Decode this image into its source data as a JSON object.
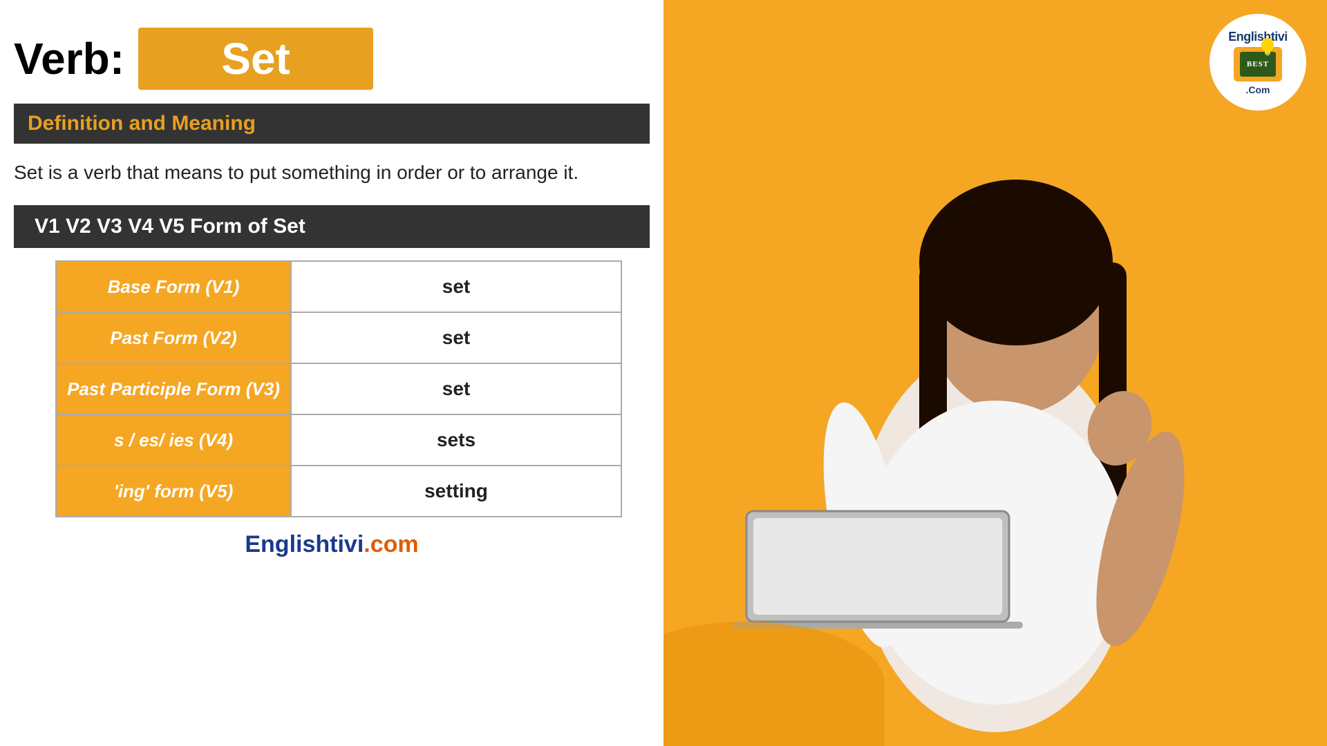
{
  "page": {
    "verb_label": "Verb:",
    "verb_word": "Set",
    "definition_heading": "Definition and Meaning",
    "definition_text": "Set is a verb that means to put something in order or to arrange it.",
    "forms_heading": "V1 V2 V3 V4 V5 Form of Set",
    "table": {
      "rows": [
        {
          "label": "Base Form (V1)",
          "value": "set"
        },
        {
          "label": "Past Form (V2)",
          "value": "set"
        },
        {
          "label": "Past Participle Form (V3)",
          "value": "set"
        },
        {
          "label": "s / es/ ies (V4)",
          "value": "sets"
        },
        {
          "label": "'ing' form (V5)",
          "value": "setting"
        }
      ]
    },
    "footer": {
      "brand_blue": "Englishtivi",
      "brand_orange": ".com"
    },
    "logo": {
      "text_top": "Englishtivi.Com",
      "tv_text": "BEST",
      "text_bottom": ".Com"
    }
  }
}
